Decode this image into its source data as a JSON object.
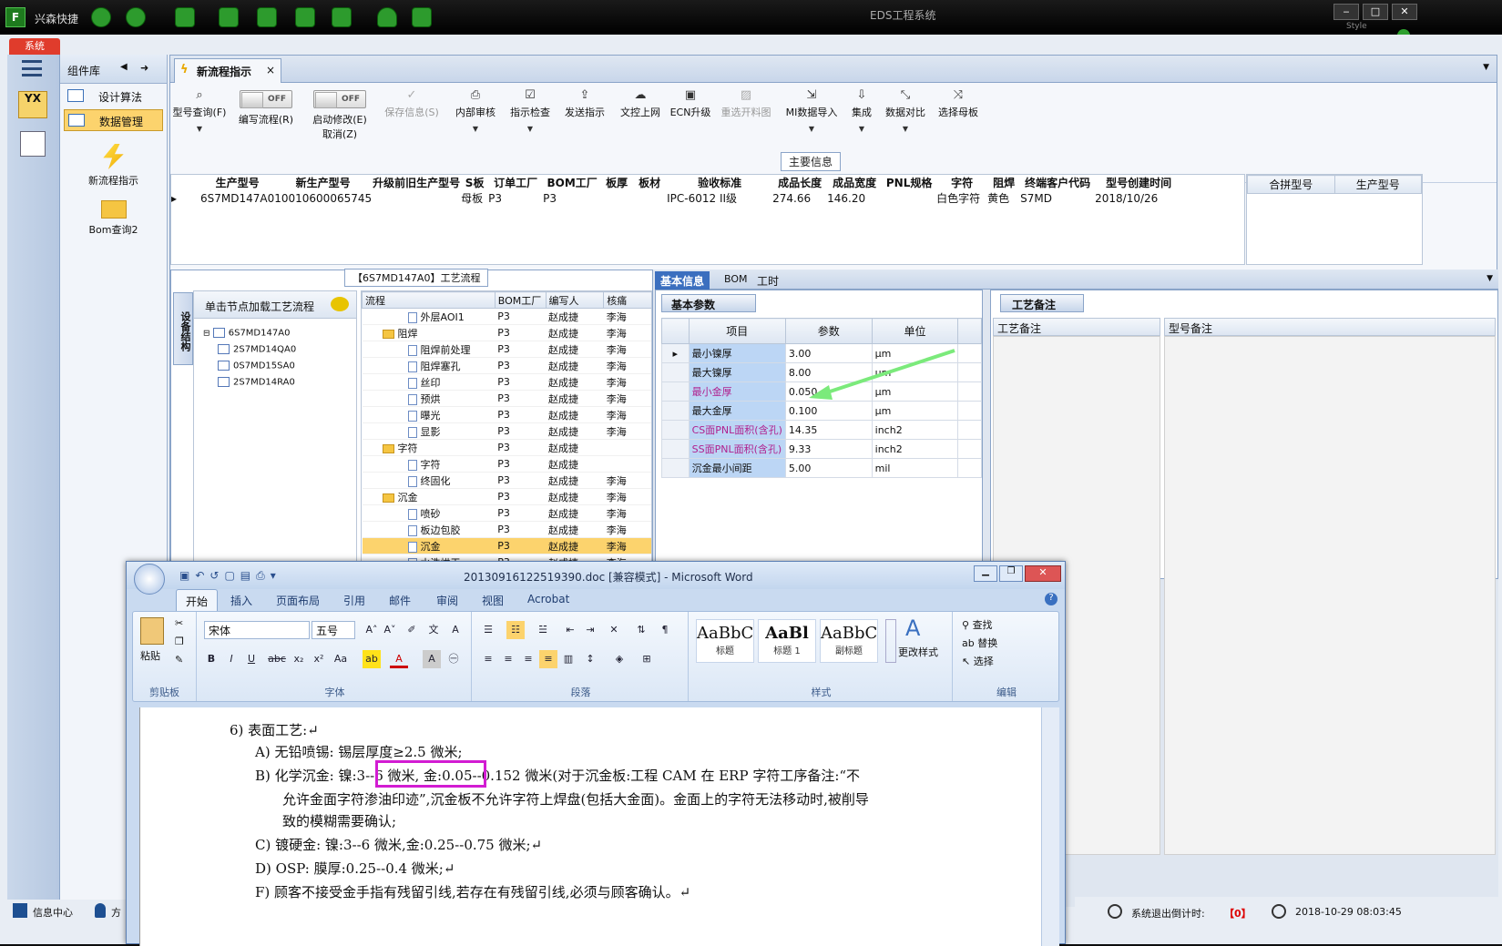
{
  "topbar": {
    "app_name": "兴森快捷",
    "system_title": "EDS工程系统",
    "style_label": "Style"
  },
  "window_controls": {
    "minimize": "‒",
    "maximize": "□",
    "close": "✕"
  },
  "system_tab": "系统",
  "component_nav": {
    "title": "组件库",
    "items": [
      {
        "label": "设计算法"
      },
      {
        "label": "数据管理"
      }
    ],
    "big_items": [
      {
        "label": "新流程指示"
      },
      {
        "label": "Bom查询2"
      }
    ]
  },
  "doc_tab": {
    "label": "新流程指示",
    "close": "×"
  },
  "ribbon": {
    "buttons": [
      {
        "label": "型号查询(F)",
        "icon": "search-icon"
      },
      {
        "label": "编写流程(R)",
        "toggle": "OFF"
      },
      {
        "label": "启动修改(E)",
        "toggle": "OFF",
        "sub": "取消(Z)"
      },
      {
        "label": "保存信息(S)",
        "disabled": true
      },
      {
        "label": "内部审核"
      },
      {
        "label": "指示检查"
      },
      {
        "label": "发送指示"
      },
      {
        "label": "文控上网"
      },
      {
        "label": "ECN升级"
      },
      {
        "label": "重选开料图",
        "disabled": true
      },
      {
        "label": "MI数据导入"
      },
      {
        "label": "集成"
      },
      {
        "label": "数据对比"
      },
      {
        "label": "选择母板"
      }
    ]
  },
  "main_info": {
    "label": "主要信息",
    "columns": [
      "生产型号",
      "新生产型号",
      "升级前旧生产型号",
      "S板",
      "订单工厂",
      "BOM工厂",
      "板厚",
      "板材",
      "验收标准",
      "成品长度",
      "成品宽度",
      "PNL规格",
      "字符",
      "阻焊",
      "终端客户代码",
      "型号创建时间"
    ],
    "row": [
      "6S7MD147A0",
      "10010600065745",
      "",
      "母板",
      "P3",
      "P3",
      "",
      "",
      "IPC-6012 II级",
      "274.66",
      "146.20",
      "",
      "白色字符",
      "黄色",
      "S7MD",
      "2018/10/26"
    ],
    "merge_columns": [
      "合拼型号",
      "生产型号"
    ]
  },
  "process": {
    "title": "【6S7MD147A0】工艺流程",
    "side_tab": "设备结构",
    "node_header": "单击节点加载工艺流程",
    "nodes": [
      "6S7MD147A0",
      "2S7MD14QA0",
      "0S7MD15SA0",
      "2S7MD14RA0"
    ],
    "flow_columns": [
      "流程",
      "BOM工厂",
      "编写人",
      "核痛"
    ],
    "flow_rows": [
      {
        "name": "外层AOI1",
        "type": "file",
        "indent": 2,
        "bom": "P3",
        "writer": "赵成捷",
        "reviewer": "李海"
      },
      {
        "name": "阻焊",
        "type": "folder",
        "indent": 1,
        "bom": "P3",
        "writer": "赵成捷",
        "reviewer": "李海"
      },
      {
        "name": "阻焊前处理",
        "type": "file",
        "indent": 2,
        "bom": "P3",
        "writer": "赵成捷",
        "reviewer": "李海"
      },
      {
        "name": "阻焊塞孔",
        "type": "file",
        "indent": 2,
        "bom": "P3",
        "writer": "赵成捷",
        "reviewer": "李海"
      },
      {
        "name": "丝印",
        "type": "file",
        "indent": 2,
        "bom": "P3",
        "writer": "赵成捷",
        "reviewer": "李海"
      },
      {
        "name": "预烘",
        "type": "file",
        "indent": 2,
        "bom": "P3",
        "writer": "赵成捷",
        "reviewer": "李海"
      },
      {
        "name": "曝光",
        "type": "file",
        "indent": 2,
        "bom": "P3",
        "writer": "赵成捷",
        "reviewer": "李海"
      },
      {
        "name": "显影",
        "type": "file",
        "indent": 2,
        "bom": "P3",
        "writer": "赵成捷",
        "reviewer": "李海"
      },
      {
        "name": "字符",
        "type": "folder",
        "indent": 1,
        "bom": "P3",
        "writer": "赵成捷",
        "reviewer": ""
      },
      {
        "name": "字符",
        "type": "file",
        "indent": 2,
        "bom": "P3",
        "writer": "赵成捷",
        "reviewer": ""
      },
      {
        "name": "终固化",
        "type": "file",
        "indent": 2,
        "bom": "P3",
        "writer": "赵成捷",
        "reviewer": "李海"
      },
      {
        "name": "沉金",
        "type": "folder",
        "indent": 1,
        "bom": "P3",
        "writer": "赵成捷",
        "reviewer": "李海"
      },
      {
        "name": "喷砂",
        "type": "file",
        "indent": 2,
        "bom": "P3",
        "writer": "赵成捷",
        "reviewer": "李海"
      },
      {
        "name": "板边包胶",
        "type": "file",
        "indent": 2,
        "bom": "P3",
        "writer": "赵成捷",
        "reviewer": "李海"
      },
      {
        "name": "沉金",
        "type": "file",
        "indent": 2,
        "bom": "P3",
        "writer": "赵成捷",
        "reviewer": "李海",
        "selected": true
      },
      {
        "name": "水洗烘干",
        "type": "file",
        "indent": 2,
        "bom": "P3",
        "writer": "赵成捷",
        "reviewer": "李海"
      }
    ]
  },
  "info_tabs": [
    "基本信息",
    "BOM",
    "工时"
  ],
  "params": {
    "title": "基本参数",
    "columns": [
      "项目",
      "参数",
      "单位"
    ],
    "rows": [
      {
        "item": "最小镍厚",
        "value": "3.00",
        "unit": "μm",
        "pink": false
      },
      {
        "item": "最大镍厚",
        "value": "8.00",
        "unit": "μm",
        "pink": false
      },
      {
        "item": "最小金厚",
        "value": "0.050",
        "unit": "μm",
        "pink": true
      },
      {
        "item": "最大金厚",
        "value": "0.100",
        "unit": "μm",
        "pink": false
      },
      {
        "item": "CS面PNL面积(含孔)",
        "value": "14.35",
        "unit": "inch2",
        "pink": true
      },
      {
        "item": "SS面PNL面积(含孔)",
        "value": "9.33",
        "unit": "inch2",
        "pink": true
      },
      {
        "item": "沉金最小间距",
        "value": "5.00",
        "unit": "mil",
        "pink": false
      }
    ]
  },
  "notes": {
    "title": "工艺备注",
    "col1": "工艺备注",
    "col2": "型号备注"
  },
  "status": {
    "logout_label": "系统退出倒计时:",
    "logout_value": "【0】",
    "datetime": "2018-10-29 08:03:45"
  },
  "taskbar": {
    "item1": "信息中心",
    "item2": "方"
  },
  "word": {
    "title": "20130916122519390.doc [兼容模式] - Microsoft Word",
    "tabs": [
      "开始",
      "插入",
      "页面布局",
      "引用",
      "邮件",
      "审阅",
      "视图",
      "Acrobat"
    ],
    "font_name": "宋体",
    "font_size": "五号",
    "groups": [
      "剪贴板",
      "字体",
      "段落",
      "样式",
      "编辑"
    ],
    "paste_label": "粘贴",
    "styles": [
      {
        "sample": "AaBbC",
        "label": "标题"
      },
      {
        "sample": "AaBl",
        "label": "标题 1"
      },
      {
        "sample": "AaBbC",
        "label": "副标题"
      }
    ],
    "change_style": "更改样式",
    "edit_items": [
      "查找",
      "替换",
      "选择"
    ],
    "body": [
      "6)  表面工艺:↵",
      "A)  无铅喷锡:  锡层厚度≥2.5 微米;",
      "B)  化学沉金:  镍:3--6 微米,  金:0.05--0.152 微米(对于沉金板:工程 CAM 在 ERP 字符工序备注:“不",
      "允许金面字符渗油印迹”,沉金板不允许字符上焊盘(包括大金面)。金面上的字符无法移动时,被削导",
      "致的模糊需要确认;",
      "C)  镀硬金:    镍:3--6 微米,金:0.25--0.75 微米;↵",
      "D)  OSP:      膜厚:0.25--0.4 微米;↵",
      "F)  顾客不接受金手指有残留引线,若存在有残留引线,必须与顾客确认。↵"
    ]
  }
}
